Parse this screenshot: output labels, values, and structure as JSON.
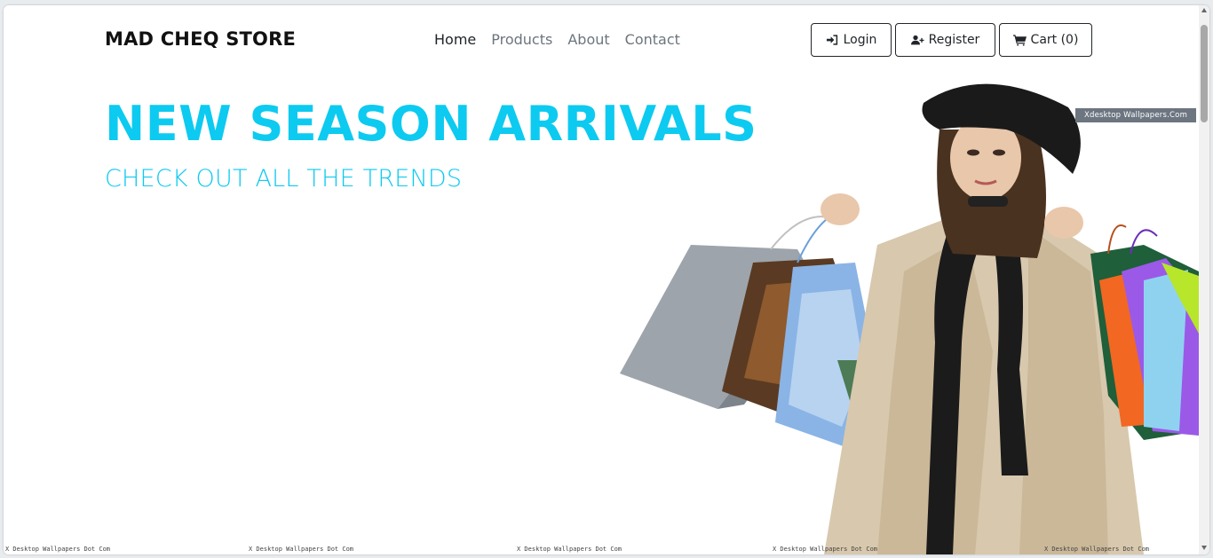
{
  "navbar": {
    "brand": "MAD CHEQ STORE",
    "links": [
      {
        "label": "Home"
      },
      {
        "label": "Products"
      },
      {
        "label": "About"
      },
      {
        "label": "Contact"
      }
    ],
    "buttons": {
      "login": "Login",
      "register": "Register",
      "cart": "Cart (0)"
    }
  },
  "hero": {
    "title": "NEW SEASON ARRIVALS",
    "subtitle": "CHECK OUT ALL THE TRENDS",
    "image_watermark": "Xdesktop Wallpapers.Com",
    "footer_watermarks": [
      "X Desktop Wallpapers Dot Com",
      "X Desktop Wallpapers Dot Com",
      "X Desktop Wallpapers Dot Com",
      "X Desktop Wallpapers Dot Com",
      "X Desktop Wallpapers Dot Com"
    ]
  },
  "colors": {
    "accent": "#0dcaf0",
    "text": "#212529",
    "muted": "#6c757d"
  },
  "icons": {
    "login": "sign-in-icon",
    "register": "user-plus-icon",
    "cart": "shopping-cart-icon"
  }
}
